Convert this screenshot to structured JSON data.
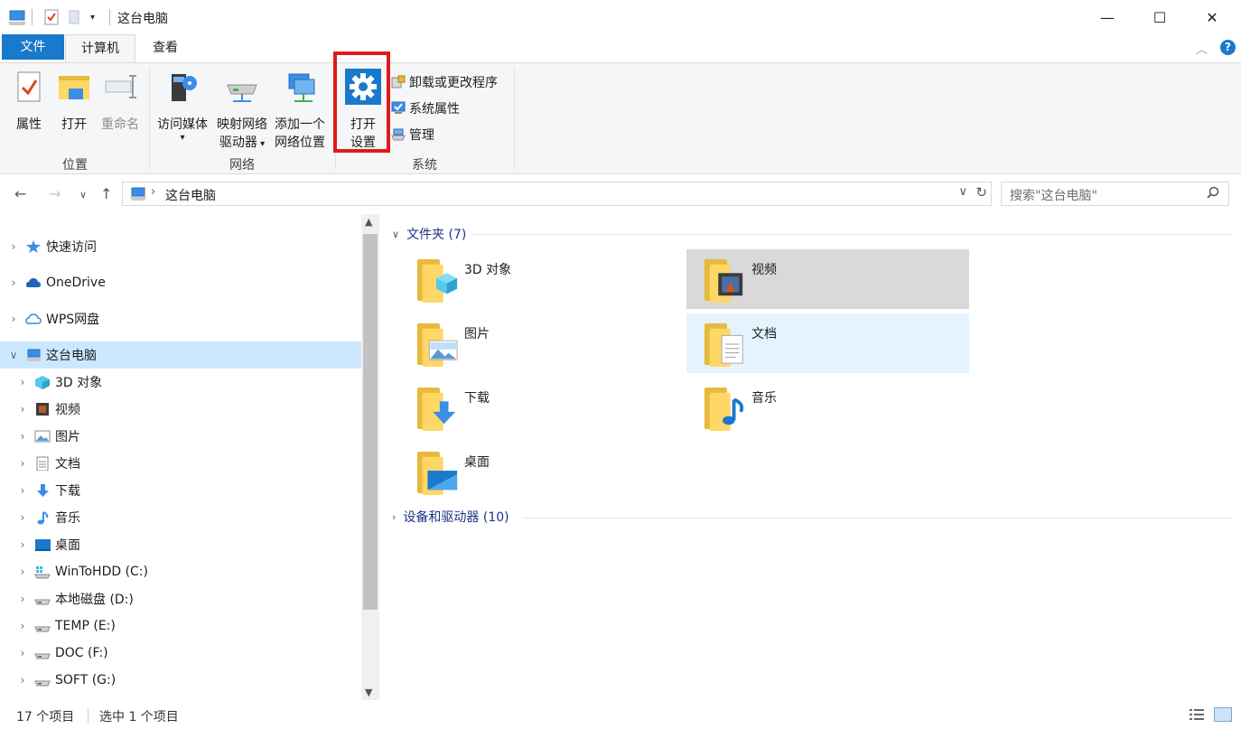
{
  "window": {
    "title": "这台电脑",
    "minimize_glyph": "—",
    "maximize_glyph": "☐",
    "close_glyph": "✕"
  },
  "ribbon_tabs": [
    {
      "label": "文件"
    },
    {
      "label": "计算机"
    },
    {
      "label": "查看"
    }
  ],
  "ribbon": {
    "groups": [
      {
        "label": "位置"
      },
      {
        "label": "网络"
      },
      {
        "label": "系统"
      }
    ],
    "buttons": {
      "properties": "属性",
      "open": "打开",
      "rename": "重命名",
      "media_line1": "访问媒体",
      "map_line1": "映射网络",
      "map_line2": "驱动器",
      "add_line1": "添加一个",
      "add_line2": "网络位置",
      "settings_line1": "打开",
      "settings_line2": "设置",
      "uninstall": "卸载或更改程序",
      "system_props": "系统属性",
      "manage": "管理"
    }
  },
  "address": {
    "path": "这台电脑",
    "search_placeholder": "搜索\"这台电脑\""
  },
  "nav_pane": [
    {
      "label": "快速访问",
      "icon": "star-icon",
      "level": 0,
      "expanded": false
    },
    {
      "label": "OneDrive",
      "icon": "onedrive-cloud-icon",
      "level": 0,
      "expanded": false
    },
    {
      "label": "WPS网盘",
      "icon": "wps-cloud-icon",
      "level": 0,
      "expanded": false
    },
    {
      "label": "这台电脑",
      "icon": "this-pc-icon",
      "level": 0,
      "expanded": true,
      "selected": true
    },
    {
      "label": "3D 对象",
      "icon": "3d-objects-icon",
      "level": 1
    },
    {
      "label": "视频",
      "icon": "videos-icon",
      "level": 1
    },
    {
      "label": "图片",
      "icon": "pictures-icon",
      "level": 1
    },
    {
      "label": "文档",
      "icon": "documents-icon",
      "level": 1
    },
    {
      "label": "下载",
      "icon": "downloads-icon",
      "level": 1
    },
    {
      "label": "音乐",
      "icon": "music-icon",
      "level": 1
    },
    {
      "label": "桌面",
      "icon": "desktop-icon",
      "level": 1
    },
    {
      "label": "WinToHDD (C:)",
      "icon": "windows-drive-icon",
      "level": 1
    },
    {
      "label": "本地磁盘 (D:)",
      "icon": "drive-icon",
      "level": 1
    },
    {
      "label": "TEMP (E:)",
      "icon": "drive-icon",
      "level": 1
    },
    {
      "label": "DOC (F:)",
      "icon": "drive-icon",
      "level": 1
    },
    {
      "label": "SOFT (G:)",
      "icon": "drive-icon",
      "level": 1
    }
  ],
  "content": {
    "folders_header": "文件夹 (7)",
    "devices_header": "设备和驱动器 (10)",
    "folders": [
      {
        "name": "3D 对象",
        "icon": "3d-objects-folder-icon",
        "state": "normal"
      },
      {
        "name": "视频",
        "icon": "videos-folder-icon",
        "state": "hover"
      },
      {
        "name": "图片",
        "icon": "pictures-folder-icon",
        "state": "normal"
      },
      {
        "name": "文档",
        "icon": "documents-folder-icon",
        "state": "selected"
      },
      {
        "name": "下载",
        "icon": "downloads-folder-icon",
        "state": "normal"
      },
      {
        "name": "音乐",
        "icon": "music-folder-icon",
        "state": "normal"
      },
      {
        "name": "桌面",
        "icon": "desktop-folder-icon",
        "state": "normal"
      }
    ]
  },
  "status": {
    "item_count": "17 个项目",
    "selection": "选中 1 个项目"
  },
  "colors": {
    "accent": "#1979ca",
    "selection": "#cce8ff",
    "highlight_box": "#e01a1a",
    "header_text": "#1e3287"
  }
}
